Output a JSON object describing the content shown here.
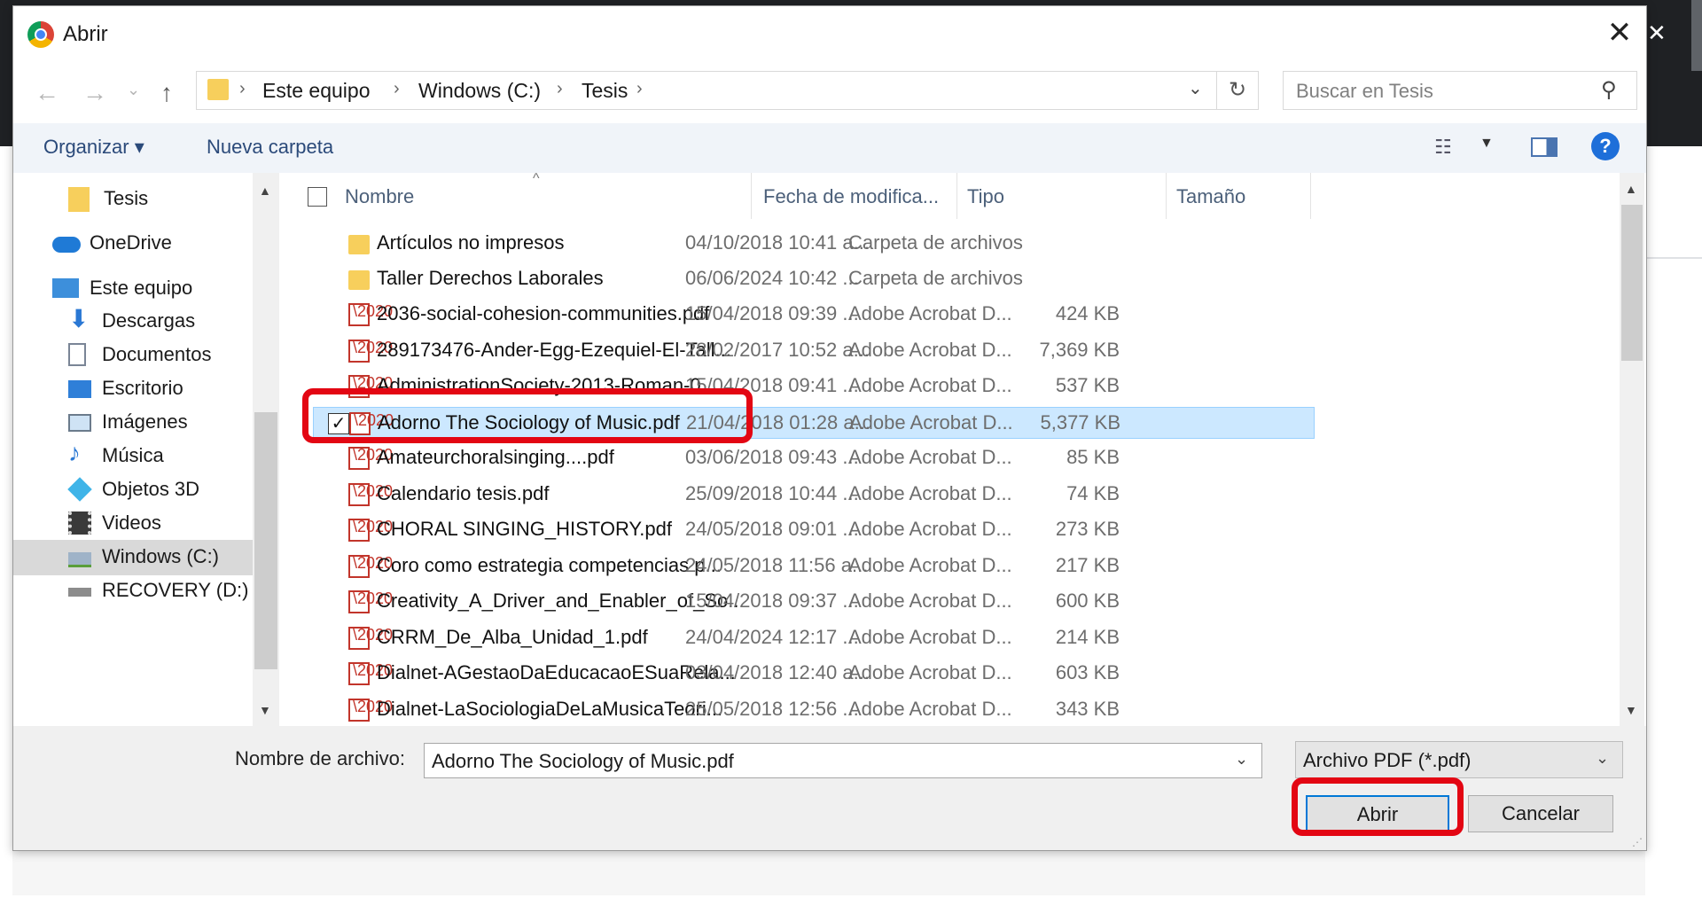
{
  "dialog": {
    "title": "Abrir",
    "close_glyph": "✕"
  },
  "nav_buttons": {
    "back": "←",
    "forward": "→",
    "recent": "⌄",
    "up": "↑"
  },
  "addressbar": {
    "crumbs": [
      "Este equipo",
      "Windows (C:)",
      "Tesis"
    ],
    "separator": "›",
    "dropdown": "⌄",
    "refresh": "↻"
  },
  "search": {
    "placeholder": "Buscar en Tesis",
    "icon": "⚲"
  },
  "cmdbar": {
    "organize": "Organizar ▾",
    "new_folder": "Nueva carpeta",
    "view_icon": "☷",
    "view_dd": "▼",
    "help": "?"
  },
  "navpane": {
    "items": [
      {
        "label": "Tesis",
        "icon": "folder-icon"
      },
      {
        "label": "OneDrive",
        "icon": "cloud-icon"
      },
      {
        "label": "Este equipo",
        "icon": "computer-icon"
      },
      {
        "label": "Descargas",
        "icon": "download-icon"
      },
      {
        "label": "Documentos",
        "icon": "document-icon"
      },
      {
        "label": "Escritorio",
        "icon": "desktop-icon"
      },
      {
        "label": "Imágenes",
        "icon": "pictures-icon"
      },
      {
        "label": "Música",
        "icon": "music-icon"
      },
      {
        "label": "Objetos 3D",
        "icon": "cube-icon"
      },
      {
        "label": "Videos",
        "icon": "video-icon"
      },
      {
        "label": "Windows (C:)",
        "icon": "drive-icon"
      },
      {
        "label": "RECOVERY (D:)",
        "icon": "drive-icon"
      }
    ],
    "scroll_up": "▲",
    "scroll_down": "▼"
  },
  "filelist": {
    "columns": {
      "name": "Nombre",
      "date": "Fecha de modifica...",
      "type": "Tipo",
      "size": "Tamaño"
    },
    "sort_caret": "^",
    "rows": [
      {
        "name": "Artículos no impresos",
        "date": "04/10/2018 10:41 a...",
        "type": "Carpeta de archivos",
        "size": "",
        "kind": "folder"
      },
      {
        "name": "Taller Derechos Laborales",
        "date": "06/06/2024 10:42 ...",
        "type": "Carpeta de archivos",
        "size": "",
        "kind": "folder"
      },
      {
        "name": "2036-social-cohesion-communities.pdf",
        "date": "15/04/2018 09:39 ...",
        "type": "Adobe Acrobat D...",
        "size": "424 KB",
        "kind": "pdf"
      },
      {
        "name": "289173476-Ander-Egg-Ezequiel-El-Tall...",
        "date": "28/02/2017 10:52 a...",
        "type": "Adobe Acrobat D...",
        "size": "7,369 KB",
        "kind": "pdf"
      },
      {
        "name": "AdministrationSociety-2013-Roman-0...",
        "date": "15/04/2018 09:41 ...",
        "type": "Adobe Acrobat D...",
        "size": "537 KB",
        "kind": "pdf"
      },
      {
        "name": "Adorno The Sociology of Music.pdf",
        "date": "21/04/2018 01:28 a...",
        "type": "Adobe Acrobat D...",
        "size": "5,377 KB",
        "kind": "pdf",
        "selected": true
      },
      {
        "name": "Amateurchoralsinging....pdf",
        "date": "03/06/2018 09:43 ...",
        "type": "Adobe Acrobat D...",
        "size": "85 KB",
        "kind": "pdf"
      },
      {
        "name": "Calendario tesis.pdf",
        "date": "25/09/2018 10:44 ...",
        "type": "Adobe Acrobat D...",
        "size": "74 KB",
        "kind": "pdf"
      },
      {
        "name": "CHORAL SINGING_HISTORY.pdf",
        "date": "24/05/2018 09:01 ...",
        "type": "Adobe Acrobat D...",
        "size": "273 KB",
        "kind": "pdf"
      },
      {
        "name": "Coro como estrategia competencias p...",
        "date": "24/05/2018 11:56 a...",
        "type": "Adobe Acrobat D...",
        "size": "217 KB",
        "kind": "pdf"
      },
      {
        "name": "Creativity_A_Driver_and_Enabler_of_So...",
        "date": "15/04/2018 09:37 ...",
        "type": "Adobe Acrobat D...",
        "size": "600 KB",
        "kind": "pdf"
      },
      {
        "name": "CRRM_De_Alba_Unidad_1.pdf",
        "date": "24/04/2024 12:17 ...",
        "type": "Adobe Acrobat D...",
        "size": "214 KB",
        "kind": "pdf"
      },
      {
        "name": "Dialnet-AGestaoDaEducacaoESuaRela...",
        "date": "03/04/2018 12:40 a...",
        "type": "Adobe Acrobat D...",
        "size": "603 KB",
        "kind": "pdf"
      },
      {
        "name": "Dialnet-LaSociologiaDeLaMusicaTeori...",
        "date": "25/05/2018 12:56 ...",
        "type": "Adobe Acrobat D...",
        "size": "343 KB",
        "kind": "pdf"
      }
    ],
    "check_glyph": "✓",
    "scroll_up": "▲",
    "scroll_down": "▼"
  },
  "bottom": {
    "filename_label": "Nombre de archivo:",
    "filename_value": "Adorno The Sociology of Music.pdf",
    "filetype_value": "Archivo PDF (*.pdf)",
    "dropdown": "⌄",
    "open_label": "Abrir",
    "cancel_label": "Cancelar",
    "grip": "⋰"
  },
  "background": {
    "close_glyph": "✕"
  },
  "colors": {
    "highlight": "#e30613",
    "selection": "#cce8ff",
    "accent": "#0078d7"
  }
}
